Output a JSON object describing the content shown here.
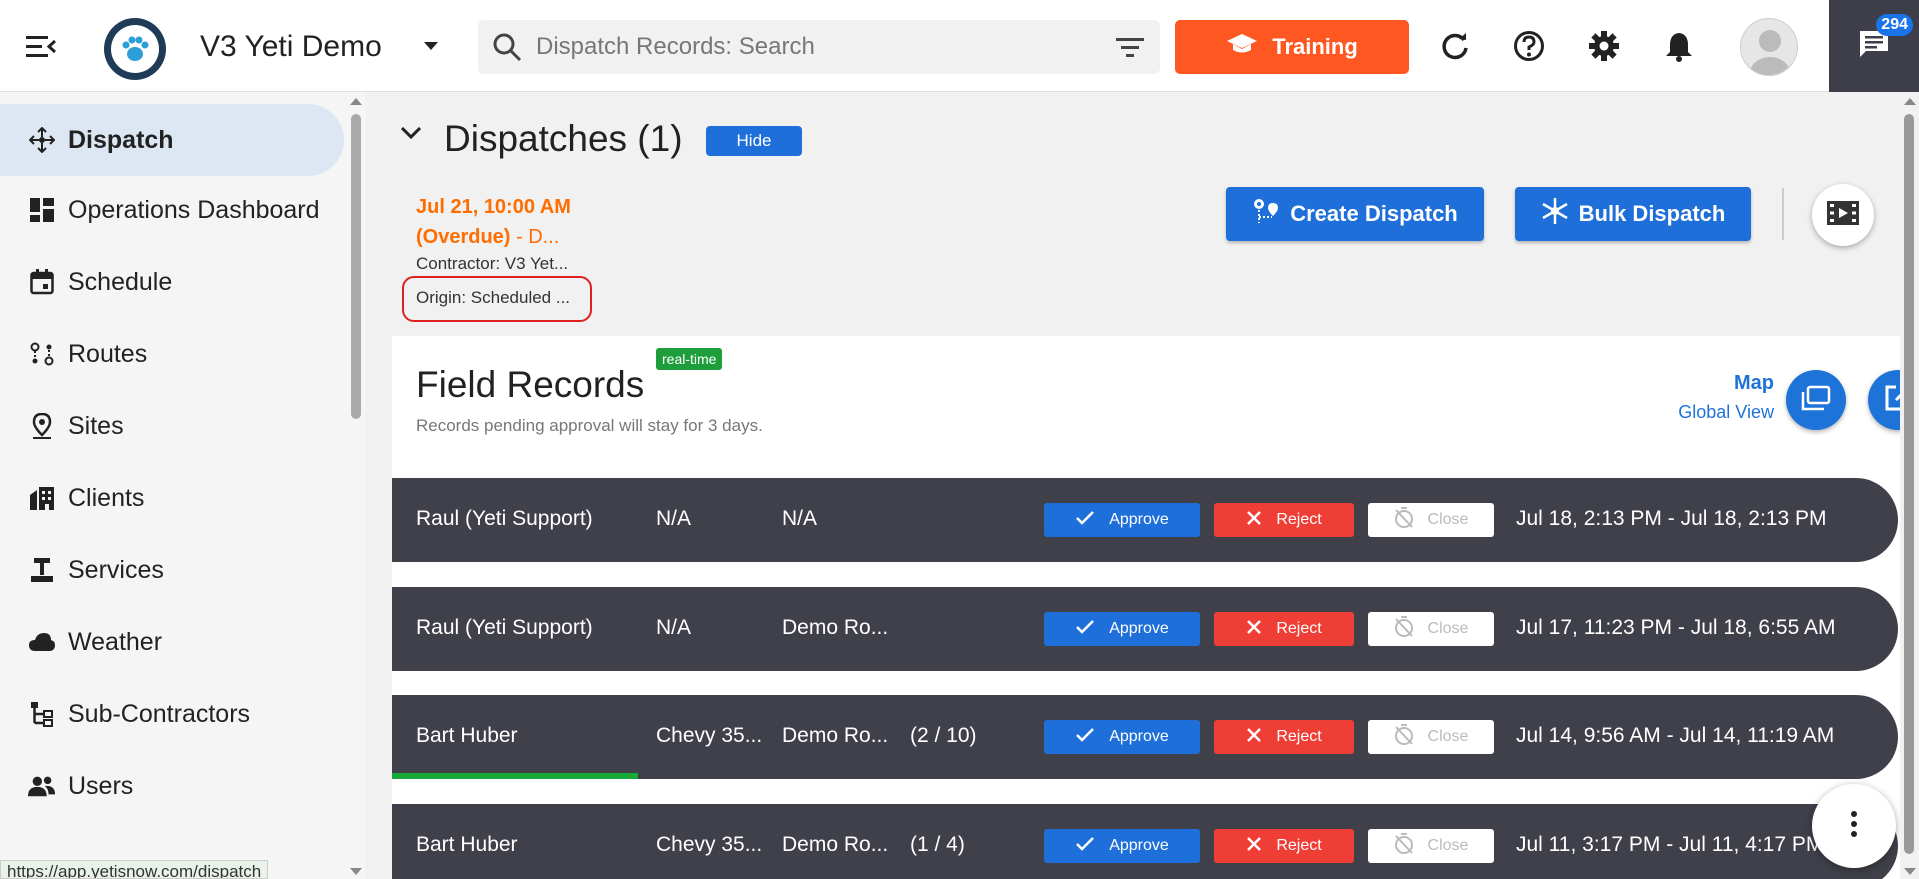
{
  "header": {
    "app_title": "V3 Yeti Demo",
    "search_placeholder": "Dispatch Records: Search",
    "training_label": "Training",
    "chat_badge_count": "294",
    "icons": [
      "menu-icon",
      "paw-logo",
      "search-icon",
      "filter-icon",
      "graduation-cap-icon",
      "refresh-icon",
      "help-icon",
      "gear-icon",
      "bell-icon",
      "user-avatar",
      "chat-icon"
    ],
    "accent_color": "#ff5722"
  },
  "sidebar": {
    "items": [
      {
        "label": "Dispatch",
        "icon": "dispatch-move-icon",
        "active": true
      },
      {
        "label": "Operations Dashboard",
        "icon": "dashboard-icon"
      },
      {
        "label": "Schedule",
        "icon": "calendar-icon"
      },
      {
        "label": "Routes",
        "icon": "routes-icon"
      },
      {
        "label": "Sites",
        "icon": "location-pin-icon"
      },
      {
        "label": "Clients",
        "icon": "building-icon"
      },
      {
        "label": "Services",
        "icon": "services-icon"
      },
      {
        "label": "Weather",
        "icon": "cloud-icon"
      },
      {
        "label": "Sub-Contractors",
        "icon": "org-tree-icon"
      },
      {
        "label": "Users",
        "icon": "users-icon"
      }
    ],
    "status_url": "https://app.yetisnow.com/dispatch"
  },
  "dispatches": {
    "title": "Dispatches (1)",
    "hide_label": "Hide",
    "date_line1": "Jul 21, 10:00 AM",
    "date_line2": "(Overdue)",
    "date_suffix": " - D...",
    "contractor": "Contractor: V3 Yet...",
    "origin": "Origin: Scheduled ...",
    "create_label": "Create Dispatch",
    "bulk_label": "Bulk Dispatch"
  },
  "field_records": {
    "title": "Field Records",
    "badge": "real-time",
    "subtitle": "Records pending approval will stay for 3 days.",
    "map_label": "Map",
    "global_label": "Global View",
    "approve_label": "Approve",
    "reject_label": "Reject",
    "close_label": "Close",
    "rows": [
      {
        "name": "Raul (Yeti Support)",
        "vehicle": "N/A",
        "route": "N/A",
        "progress": "",
        "range": "Jul 18, 2:13 PM - Jul 18, 2:13 PM",
        "progress_fraction": 0
      },
      {
        "name": "Raul (Yeti Support)",
        "vehicle": "N/A",
        "route": "Demo Ro...",
        "progress": "",
        "range": "Jul 17, 11:23 PM - Jul 18, 6:55 AM",
        "progress_fraction": 0
      },
      {
        "name": "Bart Huber",
        "vehicle": "Chevy 35...",
        "route": "Demo Ro...",
        "progress": "(2 / 10)",
        "range": "Jul 14, 9:56 AM - Jul 14, 11:19 AM",
        "progress_fraction": 0.2
      },
      {
        "name": "Bart Huber",
        "vehicle": "Chevy 35...",
        "route": "Demo Ro...",
        "progress": "(1 / 4)",
        "range": "Jul 11, 3:17 PM - Jul 11, 4:17 PM",
        "progress_fraction": 0.25
      }
    ]
  }
}
